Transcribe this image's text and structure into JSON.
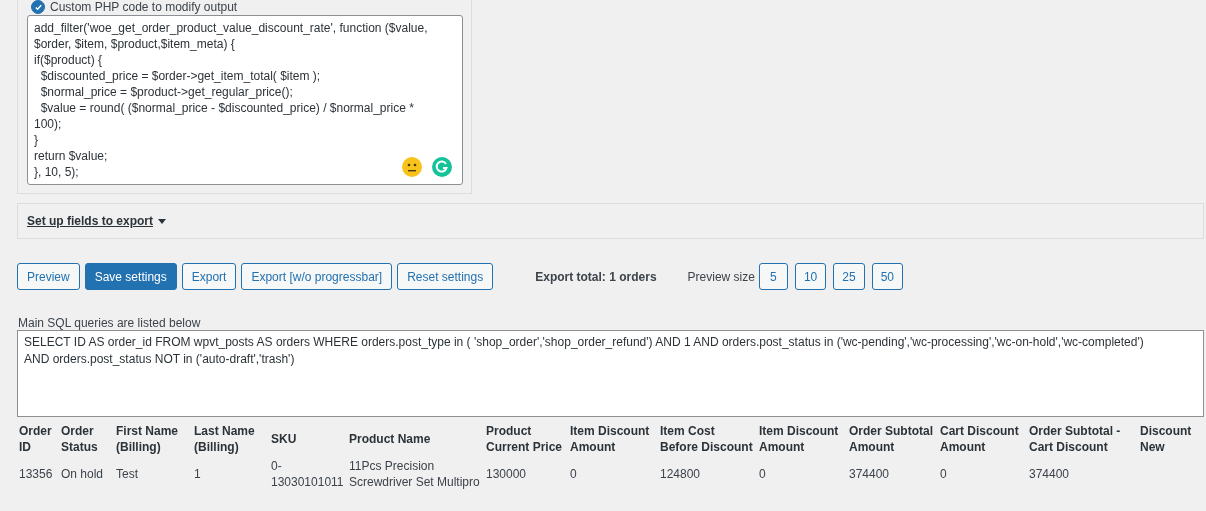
{
  "php_option": {
    "label": "Custom PHP code to modify output",
    "checked": true,
    "code_lines": [
      "add_filter('woe_get_order_product_value_discount_rate', function ($value,",
      "$order, $item, $product,$item_meta) {",
      "if($product) {",
      "  $discounted_price = $order->get_item_total( $item );",
      "  $normal_price = $product->get_regular_price();",
      "  $value = round( ($normal_price - $discounted_price) / $normal_price *",
      "100);",
      "}",
      "return $value;",
      "}, 10, 5);"
    ]
  },
  "fields_section": {
    "title": "Set up fields to export",
    "expanded": false
  },
  "buttons": [
    {
      "label": "Preview",
      "kind": "secondary"
    },
    {
      "label": "Save settings",
      "kind": "primary"
    },
    {
      "label": "Export",
      "kind": "secondary"
    },
    {
      "label": "Export [w/o progressbar]",
      "kind": "secondary"
    },
    {
      "label": "Reset settings",
      "kind": "secondary"
    }
  ],
  "export_total": "Export total: 1 orders",
  "preview_size": {
    "label": "Preview size",
    "options": [
      "5",
      "10",
      "25",
      "50"
    ]
  },
  "sql": {
    "label": "Main SQL queries are listed below",
    "value": "SELECT ID AS order_id FROM wpvt_posts AS orders WHERE orders.post_type in ( 'shop_order','shop_order_refund') AND 1 AND orders.post_status in ('wc-pending','wc-processing','wc-on-hold','wc-completed')\nAND orders.post_status NOT in ('auto-draft','trash')"
  },
  "table": {
    "columns": [
      "Order ID",
      "Order Status",
      "First Name (Billing)",
      "Last Name (Billing)",
      "SKU",
      "Product Name",
      "Product Current Price",
      "Item Discount Amount",
      "Item Cost Before Discount",
      "Item Discount Amount",
      "Order Subtotal Amount",
      "Cart Discount Amount",
      "Order Subtotal - Cart Discount",
      "Discount New"
    ],
    "rows": [
      [
        "13356",
        "On hold",
        "Test",
        "1",
        "0-13030101011",
        "11Pcs Precision Screwdriver Set Multipro",
        "130000",
        "0",
        "124800",
        "0",
        "374400",
        "0",
        "374400",
        ""
      ]
    ]
  }
}
